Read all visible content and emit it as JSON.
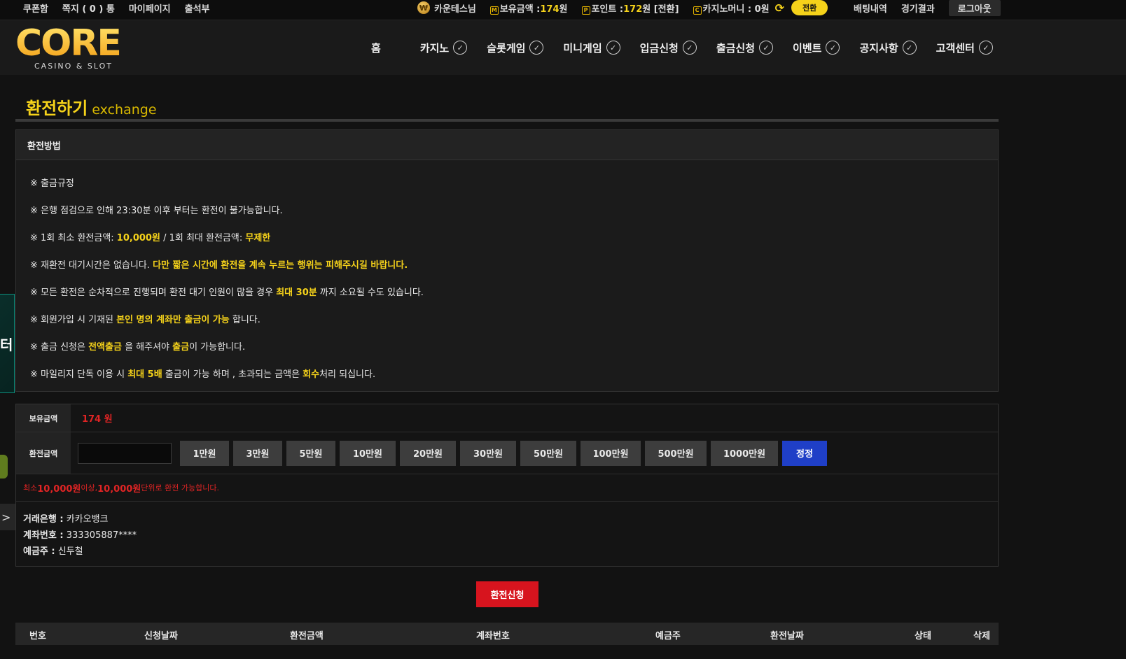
{
  "topbar": {
    "coupon": "쿠폰함",
    "memo": "쪽지 ( 0 ) 통",
    "mypage": "마이페이지",
    "attendance": "출석부",
    "user": "카운테스님",
    "balance_label": "보유금액 :",
    "balance_value": "174",
    "balance_unit": "원",
    "point_label": "포인트 :",
    "point_value": "172",
    "point_unit": "원 [전환]",
    "casino_label": "카지노머니 : 0원",
    "swap": "전환",
    "bet_history": "배팅내역",
    "results": "경기결과",
    "logout": "로그아웃"
  },
  "logo": {
    "text": "CORE",
    "sub": "CASINO & SLOT"
  },
  "nav": [
    "홈",
    "카지노",
    "슬롯게임",
    "미니게임",
    "입금신청",
    "출금신청",
    "이벤트",
    "공지사항",
    "고객센터"
  ],
  "side_banner_text": "터",
  "page": {
    "title": "환전하기",
    "subtitle": "exchange"
  },
  "method": {
    "heading": "환전방법",
    "rules": [
      [
        {
          "t": "※ 출금규정"
        }
      ],
      [
        {
          "t": "※ 은행 점검으로 인해 23:30분 이후 부터는 환전이 불가능합니다."
        }
      ],
      [
        {
          "t": "※ 1회 최소 환전금액: "
        },
        {
          "t": "10,000원",
          "hl": true
        },
        {
          "t": " / 1회 최대 환전금액: "
        },
        {
          "t": "무제한",
          "hl": true
        }
      ],
      [
        {
          "t": "※ 재환전 대기시간은 없습니다. "
        },
        {
          "t": "다만 짧은 시간에 환전을 계속 누르는 행위는 피해주시길 바랍니다.",
          "hl": true
        }
      ],
      [
        {
          "t": "※ 모든 환전은 순차적으로 진행되며 환전 대기 인원이 많을 경우 "
        },
        {
          "t": "최대 30분",
          "hl": true
        },
        {
          "t": " 까지 소요될 수도 있습니다."
        }
      ],
      [
        {
          "t": "※ 회원가입 시 기재된 "
        },
        {
          "t": "본인 명의 계좌만 출금이 가능",
          "hl": true
        },
        {
          "t": " 합니다."
        }
      ],
      [
        {
          "t": "※ 출금 신청은 "
        },
        {
          "t": "전액출금",
          "hl": true
        },
        {
          "t": " 을 해주셔야 "
        },
        {
          "t": "출금",
          "hl": true
        },
        {
          "t": "이 가능합니다."
        }
      ],
      [
        {
          "t": "※ 마일리지 단독 이용 시 "
        },
        {
          "t": "최대 5배",
          "hl": true
        },
        {
          "t": " 출금이 가능 하며 , 초과되는 금액은 "
        },
        {
          "t": "회수",
          "hl": true
        },
        {
          "t": "처리 되십니다."
        }
      ]
    ]
  },
  "form": {
    "balance_label": "보유금액",
    "balance_value": "174 원",
    "amount_label": "환전금액",
    "amount_value": "",
    "quick_buttons": [
      "1만원",
      "3만원",
      "5만원",
      "10만원",
      "20만원",
      "30만원",
      "50만원",
      "100만원",
      "500만원",
      "1000만원"
    ],
    "reset": "정정",
    "notice_prefix": "최소 ",
    "notice_min": "10,000원",
    "notice_mid": " 이상, ",
    "notice_unit": "10,000원",
    "notice_suffix": " 단위로 환전 가능합니다."
  },
  "bank": {
    "bank_label": "거래은행 :",
    "bank_value": " 카카오뱅크",
    "account_label": "계좌번호 :",
    "account_value": " 333305887****",
    "holder_label": "예금주 :",
    "holder_value": " 신두철"
  },
  "submit": "환전신청",
  "table": {
    "columns": [
      "번호",
      "신청날짜",
      "환전금액",
      "계좌번호",
      "예금주",
      "환전날짜",
      "상태",
      "삭제"
    ]
  },
  "colors": {
    "accent": "#f5d21a",
    "danger": "#d7141e",
    "reset": "#1f3fc7"
  }
}
